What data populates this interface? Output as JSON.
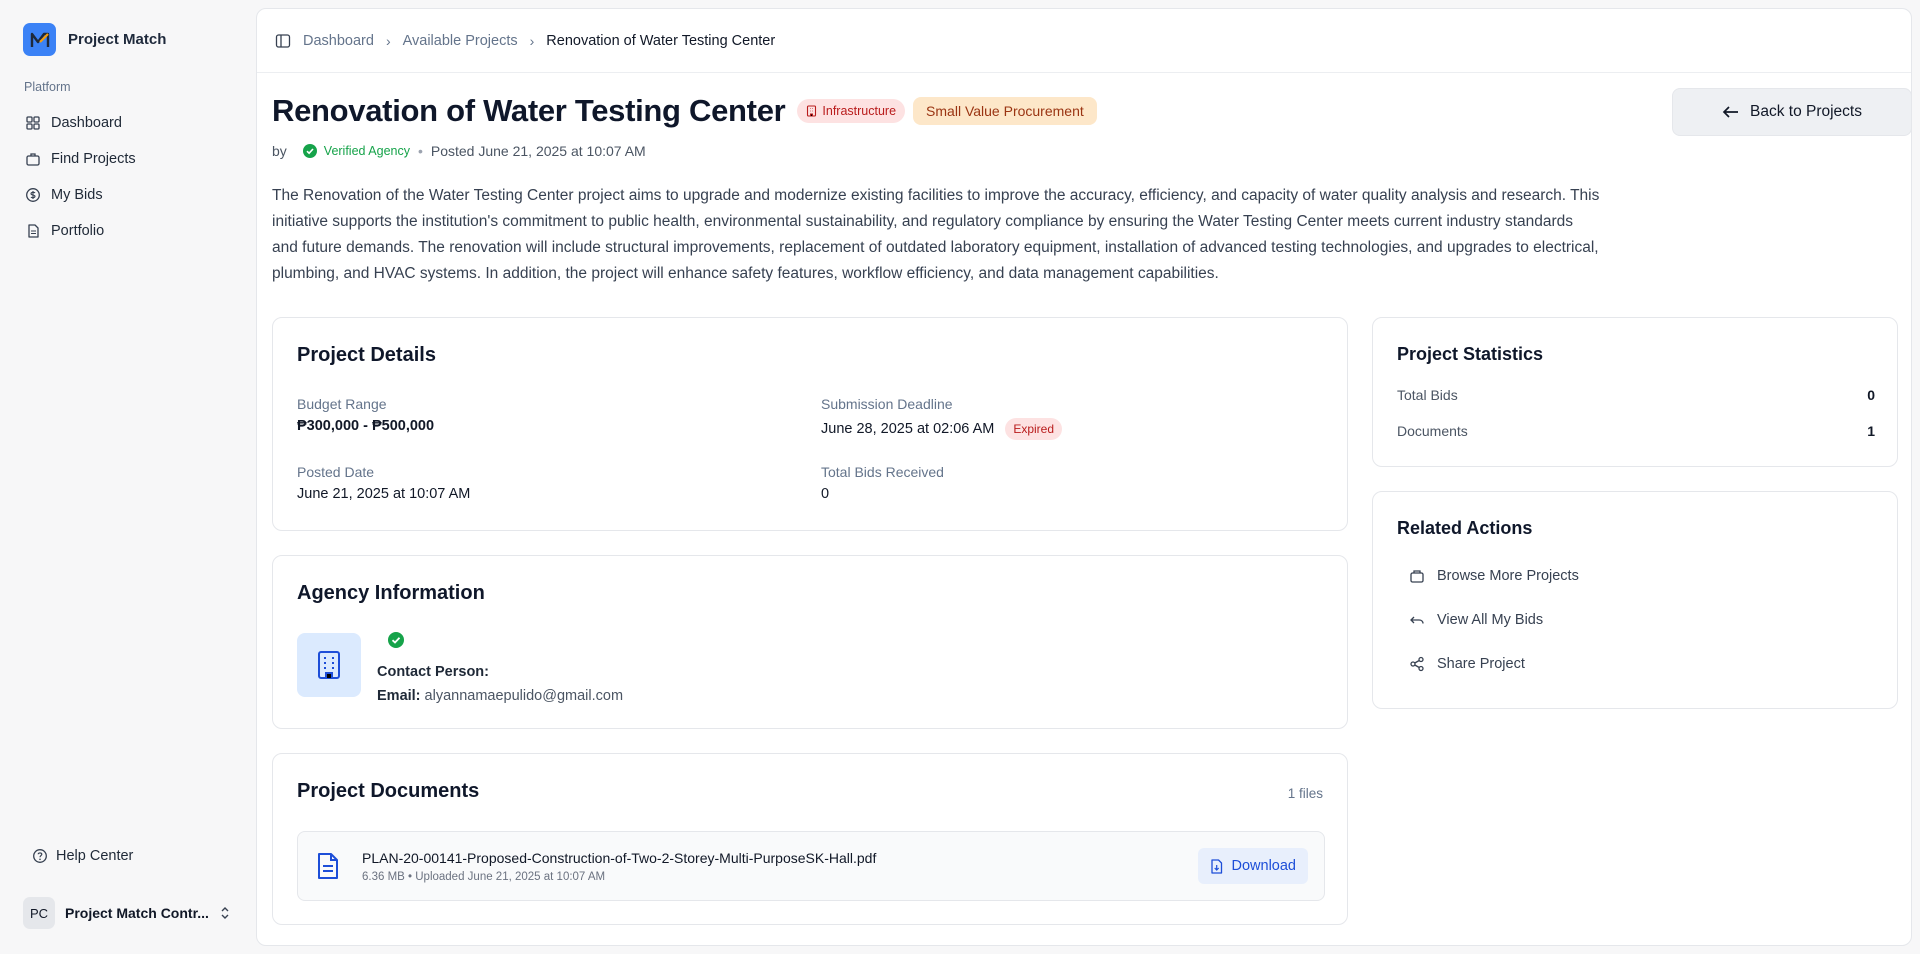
{
  "app": {
    "name": "Project Match",
    "accent": "#3b82f6"
  },
  "sidebar": {
    "group_label": "Platform",
    "items": [
      {
        "label": "Dashboard",
        "icon": "grid-icon"
      },
      {
        "label": "Find Projects",
        "icon": "briefcase-icon"
      },
      {
        "label": "My Bids",
        "icon": "dollar-circle-icon"
      },
      {
        "label": "Portfolio",
        "icon": "document-icon"
      }
    ],
    "help_label": "Help Center",
    "user": {
      "initials": "PC",
      "name": "Project Match Contr..."
    }
  },
  "breadcrumb": [
    "Dashboard",
    "Available Projects",
    "Renovation of Water Testing Center"
  ],
  "project": {
    "title": "Renovation of Water Testing Center",
    "category_badge": "Infrastructure",
    "type_badge": "Small Value Procurement",
    "by_label": "by",
    "verified_label": "Verified Agency",
    "posted_label": "Posted June 21, 2025 at 10:07 AM",
    "back_button": "Back to Projects",
    "description": "The Renovation of the Water Testing Center project aims to upgrade and modernize existing facilities to improve the accuracy, efficiency, and capacity of water quality analysis and research. This initiative supports the institution's commitment to public health, environmental sustainability, and regulatory compliance by ensuring the Water Testing Center meets current industry standards and future demands. The renovation will include structural improvements, replacement of outdated laboratory equipment, installation of advanced testing technologies, and upgrades to electrical, plumbing, and HVAC systems. In addition, the project will enhance safety features, workflow efficiency, and data management capabilities."
  },
  "details": {
    "title": "Project Details",
    "budget_label": "Budget Range",
    "budget_value": "₱300,000 - ₱500,000",
    "deadline_label": "Submission Deadline",
    "deadline_value": "June 28, 2025 at 02:06 AM",
    "deadline_status": "Expired",
    "posted_label": "Posted Date",
    "posted_value": "June 21, 2025 at 10:07 AM",
    "bids_label": "Total Bids Received",
    "bids_value": "0"
  },
  "agency": {
    "title": "Agency Information",
    "contact_label": "Contact Person:",
    "email_label": "Email:",
    "email_value": "alyannamaepulido@gmail.com"
  },
  "documents": {
    "title": "Project Documents",
    "count_label": "1 files",
    "files": [
      {
        "name": "PLAN-20-00141-Proposed-Construction-of-Two-2-Storey-Multi-PurposeSK-Hall.pdf",
        "meta": "6.36 MB • Uploaded June 21, 2025 at 10:07 AM",
        "action": "Download"
      }
    ]
  },
  "stats": {
    "title": "Project Statistics",
    "rows": [
      {
        "label": "Total Bids",
        "value": "0"
      },
      {
        "label": "Documents",
        "value": "1"
      }
    ]
  },
  "related": {
    "title": "Related Actions",
    "items": [
      {
        "label": "Browse More Projects",
        "icon": "folder-icon"
      },
      {
        "label": "View All My Bids",
        "icon": "undo-icon"
      },
      {
        "label": "Share Project",
        "icon": "share-icon"
      }
    ]
  }
}
